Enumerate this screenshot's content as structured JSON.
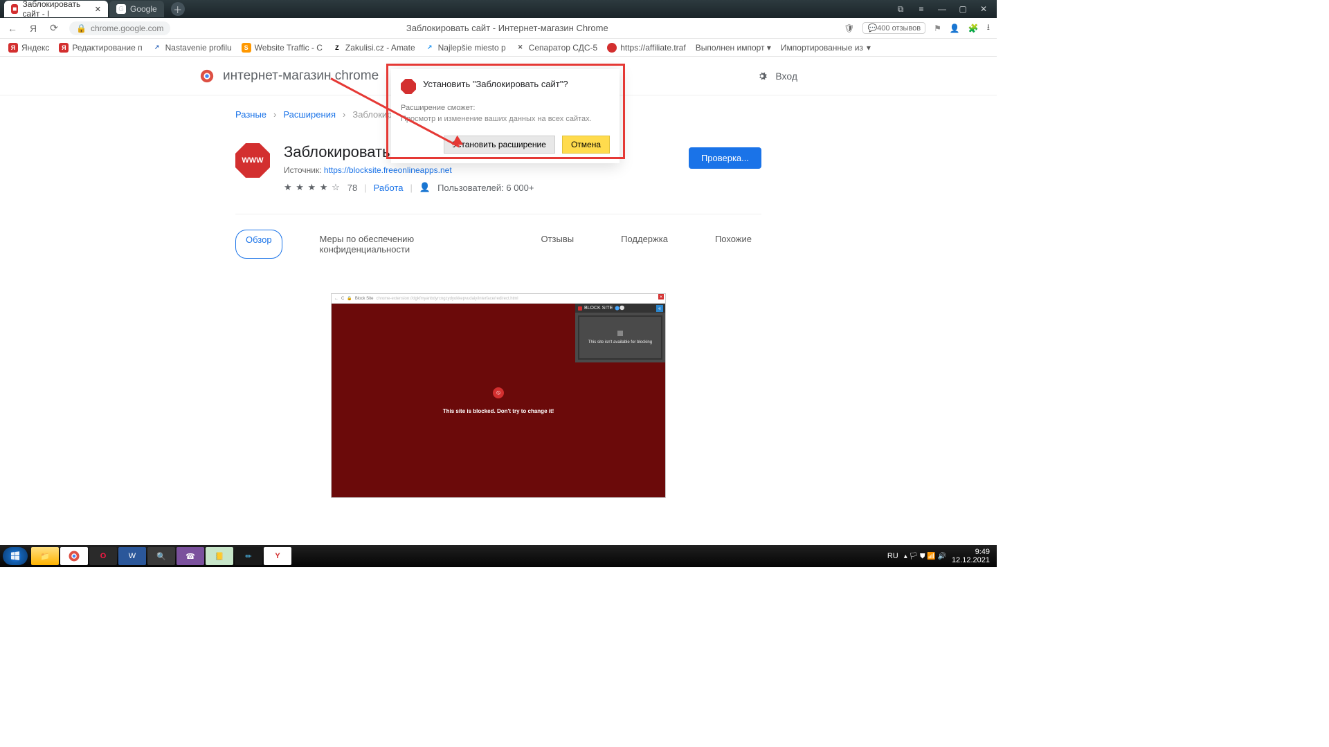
{
  "titlebar": {
    "tabs": [
      {
        "label": "Заблокировать сайт - I",
        "active": true
      },
      {
        "label": "Google",
        "active": false
      }
    ]
  },
  "toolbar": {
    "url_host": "chrome.google.com",
    "page_title": "Заблокировать сайт - Интернет-магазин Chrome",
    "reviews_pill": "400 отзывов"
  },
  "bookmarks": [
    {
      "label": "Яндекс",
      "color": "#d32f2f",
      "letter": "Я"
    },
    {
      "label": "Редактирование п",
      "color": "#d32f2f",
      "letter": "Я"
    },
    {
      "label": "Nastavenie profilu",
      "color": "#3b5998",
      "letter": "↗"
    },
    {
      "label": "Website Traffic - C",
      "color": "#ff9800",
      "letter": "S"
    },
    {
      "label": "Zakulisi.cz - Amate",
      "color": "#333",
      "letter": "Z"
    },
    {
      "label": "Najlepšie miesto p",
      "color": "#2196f3",
      "letter": "↗"
    },
    {
      "label": "Сепаратор СДС-5",
      "color": "#555",
      "letter": "X"
    },
    {
      "label": "https://affiliate.traf",
      "color": "#d32f2f",
      "letter": "●"
    },
    {
      "label": "Выполнен импорт ▾",
      "color": "transparent",
      "letter": ""
    },
    {
      "label": "Импортированные из",
      "color": "transparent",
      "letter": ""
    }
  ],
  "store": {
    "brand": "интернет-магазин chrome",
    "signin": "Вход",
    "breadcrumbs": {
      "home": "Разные",
      "ext": "Расширения",
      "current": "Заблокиров"
    },
    "extension": {
      "name": "Заблокировать",
      "source_prefix": "Источник:",
      "source_url": "https://blocksite.freeonlineapps.net",
      "rating_count": "78",
      "category": "Работа",
      "users": "Пользователей: 6 000+",
      "check_button": "Проверка..."
    },
    "tabs": {
      "overview": "Обзор",
      "privacy": "Меры по обеспечению конфиденциальности",
      "reviews": "Отзывы",
      "support": "Поддержка",
      "related": "Похожие"
    },
    "screenshot": {
      "addr_label": "Block Site",
      "addr_url": "chrome-extension://dgkfmyanbdyrcngzydyokkepvudaiy/interface/redirect.html",
      "blocked_msg": "This site is blocked. Don't try to change it!",
      "popup_title": "BLOCK SITE",
      "popup_body": "This site isn't available for blocking"
    }
  },
  "dialog": {
    "title": "Установить \"Заблокировать сайт\"?",
    "sub": "Расширение сможет:",
    "perm": "Просмотр и изменение ваших данных на всех сайтах.",
    "install": "Установить расширение",
    "cancel": "Отмена"
  },
  "taskbar": {
    "lang": "RU",
    "time": "9:49",
    "date": "12.12.2021"
  }
}
